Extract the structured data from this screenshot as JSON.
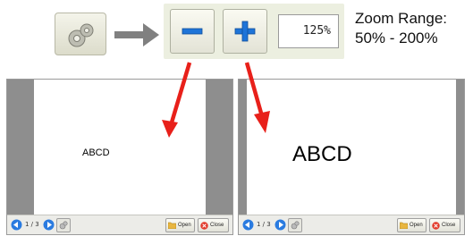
{
  "toolbar": {
    "zoom_value": "125%",
    "zoom_range_label": "Zoom Range:",
    "zoom_range_value": "50% - 200%"
  },
  "viewer_left": {
    "document_text": "ABCD",
    "page_indicator": "1 / 3",
    "open_label": "Open",
    "close_label": "Close"
  },
  "viewer_right": {
    "document_text": "ABCD",
    "page_indicator": "1 / 3",
    "open_label": "Open",
    "close_label": "Close"
  },
  "colors": {
    "arrow_red": "#e8201a",
    "blue_icon": "#1e74d8",
    "gray_arrow": "#808080"
  }
}
